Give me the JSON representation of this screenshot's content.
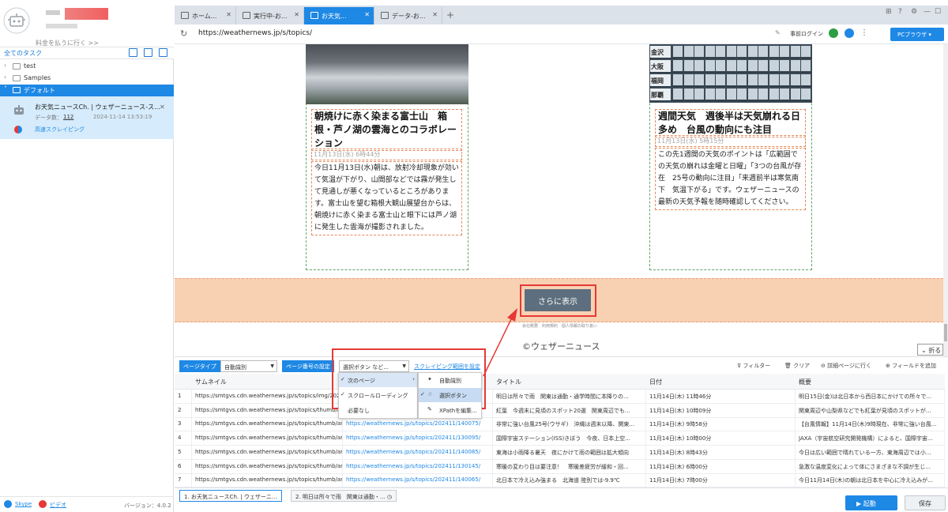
{
  "sidebar": {
    "upgrade": "料金を払うに行く >>",
    "tasks_title": "全てのタスク",
    "tree": [
      {
        "label": "test"
      },
      {
        "label": "Samples"
      },
      {
        "label": "デフォルト"
      }
    ],
    "task": {
      "name": "お天気ニュースCh. | ウェザーニュース-ス...",
      "count_label": "データ数：",
      "count": "112",
      "date": "2024-11-14 13:53:19",
      "mode": "高速スクレイピング"
    },
    "footer": {
      "skype": "Skype",
      "video": "ビデオ",
      "version": "バージョン：4.0.2"
    }
  },
  "tabs": [
    {
      "label": "ホーム..."
    },
    {
      "label": "実行中-お..."
    },
    {
      "label": "お天気..."
    },
    {
      "label": "データ-お..."
    }
  ],
  "address": {
    "url": "https://weathernews.jp/s/topics/",
    "prelogin": "事前ログイン",
    "browser": "PCブラウザ"
  },
  "page": {
    "card1": {
      "title": "朝焼けに赤く染まる富士山　箱根・芦ノ湖の雲海とのコラボレーション",
      "date": "11月13日(水) 6時44分",
      "body": "今日11月13日(水)朝は、放射冷却現象が効いて気温が下がり、山間部などでは霧が発生して見通しが悪くなっているところがあります。富士山を望む箱根大観山展望台からは、朝焼けに赤く染まる富士山と眼下には芦ノ湖に発生した雲海が撮影されました。"
    },
    "card2": {
      "cities": [
        "金沢",
        "大阪",
        "福岡",
        "那覇"
      ],
      "title": "週間天気　週後半は天気崩れる日多め　台風の動向にも注目",
      "date": "11月13日(水) 5時15分",
      "body": "この先1週間の天気のポイントは「広範囲での天気の崩れは金曜と日曜」「3つの台風が存在　25号の動向に注目」「来週前半は寒気南下　気温下がる」です。ウェザーニュースの最新の天気予報を随時確認してください。"
    },
    "more_button": "さらに表示",
    "footer_links": "会社概要　利用規約　個人情報の取り扱い",
    "copyright": "©ウェザーニュース",
    "fold": "折る"
  },
  "toolbar": {
    "page_type_label": "ページタイプ",
    "page_type_value": "自動識別",
    "page_number_label": "ページ番号の設定",
    "page_number_value": "選択ボタン など...",
    "scope_link": "スクレイピング範囲を設定",
    "filter": "フィルター",
    "clear": "クリア",
    "detail": "詳細ページに行く",
    "add_field": "フィールドを追加"
  },
  "menu": {
    "level1": [
      "次のページ",
      "スクロールローディング",
      "必要なし"
    ],
    "level2": [
      "自動識別",
      "選択ボタン",
      "XPathを編集..."
    ]
  },
  "grid": {
    "columns": [
      "サムネイル",
      "タイトル",
      "日付",
      "概要"
    ],
    "rows": [
      {
        "n": "1",
        "thumb": "https://smtgvs.cdn.weathernews.jp/s/topics/img/2024...",
        "link": "https://weathernews.jp/s/topics/202411/130125/",
        "title": "明日は所々で雨　関東は通勤・通学時間に本降りの...",
        "date": "11月14日(木) 11時46分",
        "summary": "明日15日(金)は北日本から西日本にかけての所々で..."
      },
      {
        "n": "2",
        "thumb": "https://smtgvs.cdn.weathernews.jp/s/topics/thumb/art...",
        "link": "https://weathernews.jp/s/topics/202411/140085/",
        "title": "紅葉　今週末に見頃のスポット20選　関東周辺でも...",
        "date": "11月14日(木) 10時09分",
        "summary": "関東周辺や山梨県などでも紅葉が見頃のスポットが..."
      },
      {
        "n": "3",
        "thumb": "https://smtgvs.cdn.weathernews.jp/s/topics/thumb/art...",
        "link": "https://weathernews.jp/s/topics/202411/140075/",
        "title": "非常に強い台風25号(ウサギ)　沖縄は週末以降、関東...",
        "date": "11月14日(木) 9時58分",
        "summary": "【台風情報】11月14日(木)9時現在、非常に強い台風..."
      },
      {
        "n": "4",
        "thumb": "https://smtgvs.cdn.weathernews.jp/s/topics/thumb/art...",
        "link": "https://weathernews.jp/s/topics/202411/130095/",
        "title": "国際宇宙ステーション(ISS)きぼう　今夜、日本上空...",
        "date": "11月14日(木) 10時00分",
        "summary": "JAXA（宇宙航空研究開発機構）によると、国際宇宙..."
      },
      {
        "n": "5",
        "thumb": "https://smtgvs.cdn.weathernews.jp/s/topics/thumb/art...",
        "link": "https://weathernews.jp/s/topics/202411/140085/",
        "title": "東海は小雨降る暑天　夜にかけて雨の範囲は拡大傾向",
        "date": "11月14日(木) 8時43分",
        "summary": "今日は広い範囲で晴れている一方、東海周辺では小..."
      },
      {
        "n": "6",
        "thumb": "https://smtgvs.cdn.weathernews.jp/s/topics/thumb/art...",
        "link": "https://weathernews.jp/s/topics/202411/130145/",
        "title": "寒暖の変わり目は要注意！　寒暖差疲労が緩和・回...",
        "date": "11月14日(木) 6時00分",
        "summary": "急激な温度変化によって体にさまざまな不調が生じ..."
      },
      {
        "n": "7",
        "thumb": "https://smtgvs.cdn.weathernews.jp/s/topics/thumb/art...",
        "link": "https://weathernews.jp/s/topics/202411/140065/",
        "title": "北日本で冷え込み強まる　北海道 陸別では-9.9℃",
        "date": "11月14日(木) 7時00分",
        "summary": "今日11月14日(木)の朝は北日本を中心に冷え込みが..."
      }
    ]
  },
  "bottom": {
    "tab1": "1. お天気ニュースCh. | ウェザーニ...",
    "tab2": "2. 明日は所々で雨　関東は通勤・...",
    "run": "起動",
    "save": "保存"
  },
  "colors": {
    "accent": "#1e88e5",
    "highlight": "#e53935",
    "load_band": "#f8d1b3"
  }
}
